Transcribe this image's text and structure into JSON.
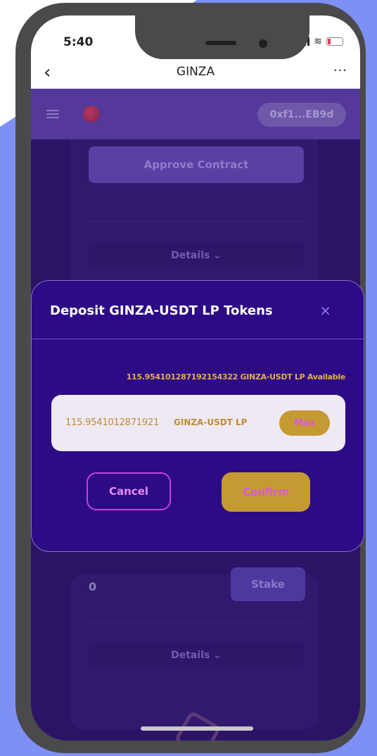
{
  "status_bar": {
    "time": "5:40",
    "wifi_icon": "wifi-icon",
    "battery_icon": "battery-icon"
  },
  "nav": {
    "back_icon": "‹",
    "title": "GINZA",
    "more_icon": "···"
  },
  "header": {
    "address": "0xf1...EB9d"
  },
  "card_top": {
    "approve_label": "Approve Contract",
    "details_label": "Details ⌄"
  },
  "card_bottom": {
    "staked_value": "0",
    "stake_label": "Stake",
    "details_label": "Details ⌄"
  },
  "modal": {
    "title": "Deposit GINZA-USDT LP Tokens",
    "close": "×",
    "available_text": "115.954101287192154322 GINZA-USDT LP Available",
    "input_value": "115.9541012871921",
    "input_unit": "GINZA-USDT LP",
    "max_label": "Max",
    "cancel_label": "Cancel",
    "confirm_label": "Confirm"
  },
  "colors": {
    "accent_gold": "#c59a33",
    "modal_bg": "#2d0a86",
    "header_purple": "#54389a",
    "background_blue": "#7f90f5"
  }
}
